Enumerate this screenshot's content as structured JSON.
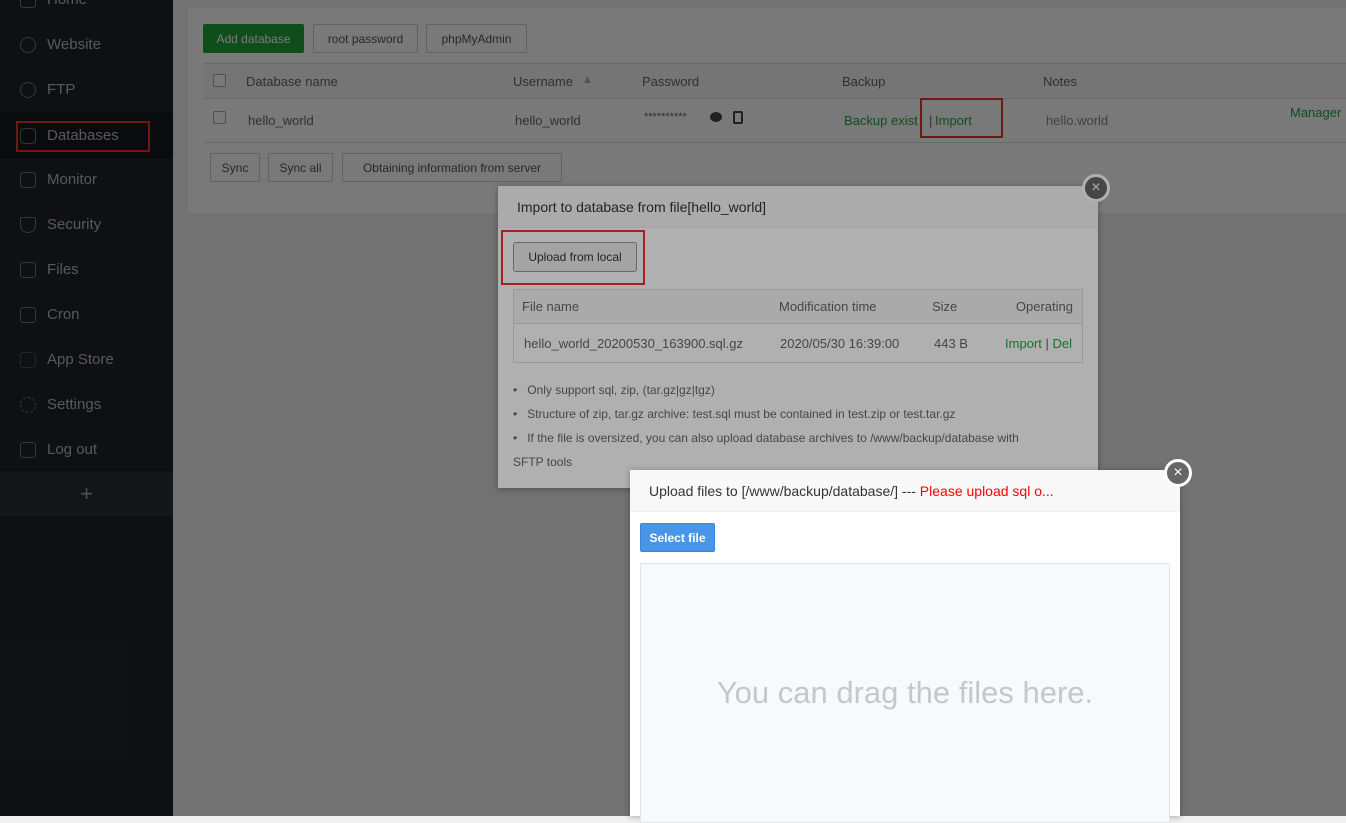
{
  "sidebar": {
    "items": [
      {
        "label": "Home"
      },
      {
        "label": "Website"
      },
      {
        "label": "FTP"
      },
      {
        "label": "Databases"
      },
      {
        "label": "Monitor"
      },
      {
        "label": "Security"
      },
      {
        "label": "Files"
      },
      {
        "label": "Cron"
      },
      {
        "label": "App Store"
      },
      {
        "label": "Settings"
      },
      {
        "label": "Log out"
      }
    ],
    "add": "+"
  },
  "toolbar": {
    "add_database": "Add database",
    "root_password": "root password",
    "phpmyadmin": "phpMyAdmin"
  },
  "table": {
    "headers": {
      "name": "Database name",
      "username": "Username",
      "sort_icon": "▲",
      "password": "Password",
      "backup": "Backup",
      "notes": "Notes"
    },
    "rows": [
      {
        "name": "hello_world",
        "username": "hello_world",
        "password": "**********",
        "backup": "Backup exist",
        "sep": "|",
        "import": "Import",
        "notes": "hello.world",
        "manager": "Manager"
      }
    ]
  },
  "bottom": {
    "sync": "Sync",
    "sync_all": "Sync all",
    "obtain": "Obtaining information from server"
  },
  "import_dialog": {
    "title": "Import to database from file[hello_world]",
    "close": "×",
    "upload_local": "Upload from local",
    "headers": {
      "file": "File name",
      "mtime": "Modification time",
      "size": "Size",
      "op": "Operating"
    },
    "files": [
      {
        "file": "hello_world_20200530_163900.sql.gz",
        "mtime": "2020/05/30 16:39:00",
        "size": "443 B",
        "import": "Import",
        "sep": "|",
        "del": "Del"
      }
    ],
    "notes": [
      "Only support sql, zip, (tar.gz|gz|tgz)",
      "Structure of zip, tar.gz archive: test.sql must be contained in test.zip or test.tar.gz",
      "If the file is oversized, you can also upload database archives to /www/backup/database with",
      "SFTP tools"
    ]
  },
  "upload_dialog": {
    "title": "Upload files to [/www/backup/database/] --- ",
    "warning": "Please upload sql o...",
    "close": "×",
    "select_file": "Select file",
    "drop_text": "You can drag the files here."
  }
}
